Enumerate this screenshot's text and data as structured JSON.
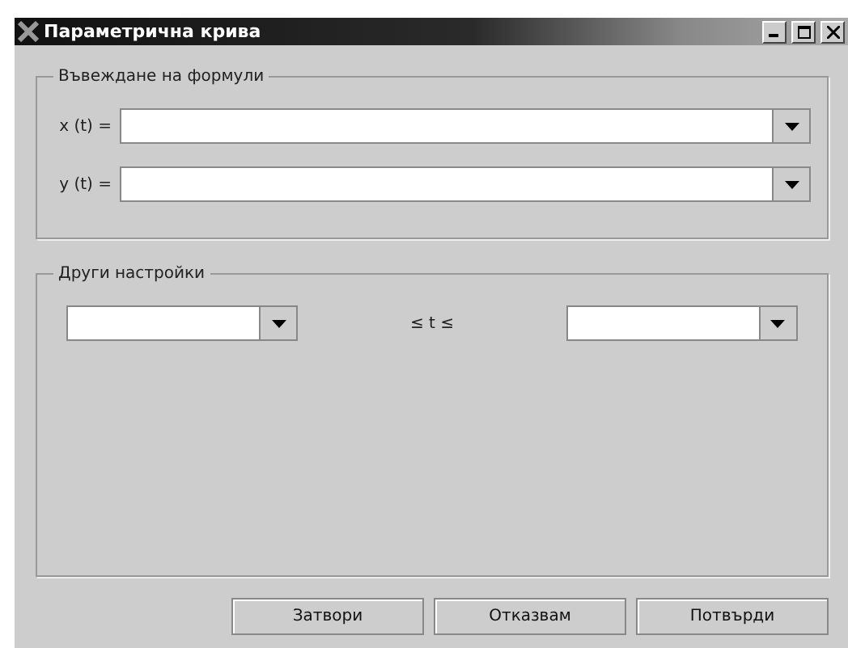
{
  "window": {
    "title": "Параметрична крива"
  },
  "formulas": {
    "title": "Въвеждане на формули",
    "rows": [
      {
        "label": "x (t) ="
      },
      {
        "label": "y (t) ="
      }
    ]
  },
  "other_settings": {
    "title": "Други настройки",
    "range_label": "≤ t ≤"
  },
  "buttons": [
    "Затвори",
    "Отказвам",
    "Потвърди"
  ]
}
